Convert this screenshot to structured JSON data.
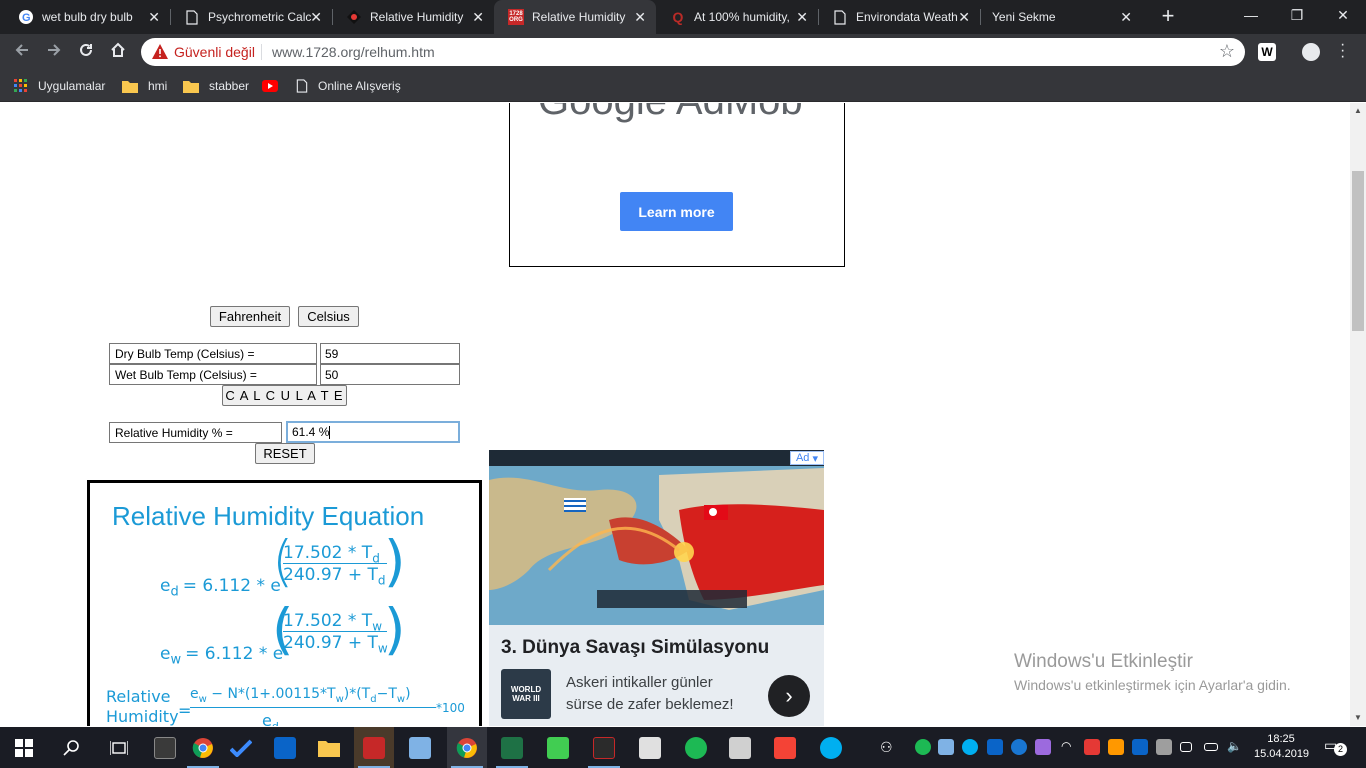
{
  "browser": {
    "tabs": [
      {
        "title": "wet bulb dry bulb",
        "active": false
      },
      {
        "title": "Psychrometric Calc",
        "active": false
      },
      {
        "title": "Relative Humidity",
        "active": false
      },
      {
        "title": "Relative Humidity",
        "active": true
      },
      {
        "title": "At 100% humidity,",
        "active": false
      },
      {
        "title": "Environdata Weath",
        "active": false
      },
      {
        "title": "Yeni Sekme",
        "active": false
      }
    ],
    "tab_favicon_1728": "1728 ORG",
    "tab_favicon_quora": "Q",
    "security_label": "Güvenli değil",
    "url": "www.1728.org/relhum.htm",
    "bookmarks": [
      "Uygulamalar",
      "hmi",
      "stabber",
      "Online Alışveriş"
    ]
  },
  "page": {
    "ad_top": {
      "logo_text": "Google AdMob",
      "cta": "Learn more"
    },
    "units": {
      "fahrenheit": "Fahrenheit",
      "celsius": "Celsius"
    },
    "form": {
      "dry_label": "Dry Bulb Temp (Celsius) =",
      "dry_value": "59",
      "wet_label": "Wet Bulb Temp (Celsius) =",
      "wet_value": "50",
      "calculate": "C A L C U L A T E",
      "rh_label": "Relative Humidity % =",
      "rh_value": "61.4 %",
      "reset": "RESET"
    },
    "equation": {
      "title": "Relative Humidity Equation",
      "ed_lhs": "e",
      "ed_sub": "d",
      "ew_sub": "w",
      "const": "= 6.112 * e",
      "num_d": "17.502 * T",
      "den_d": "240.97 + T",
      "rh_lhs_1": "Relative",
      "rh_lhs_2": "Humidity",
      "rh_num": "e",
      "rh_num_rest": " − N*(1+.00115*T",
      "rh_num_rest2": ")*(T",
      "rh_num_rest3": "−T",
      "rh_times": "*100"
    },
    "ad_game": {
      "label": "Ad",
      "headline": "3. Dünya Savaşı Simülasyonu",
      "logo_text": "WORLD WAR III",
      "description": "Askeri intikaller günler sürse de zafer beklemez!"
    },
    "watermark": {
      "line1": "Windows'u Etkinleştir",
      "line2": "Windows'u etkinleştirmek için Ayarlar'a gidin."
    }
  },
  "taskbar": {
    "time": "18:25",
    "date": "15.04.2019",
    "notification_count": "2"
  }
}
